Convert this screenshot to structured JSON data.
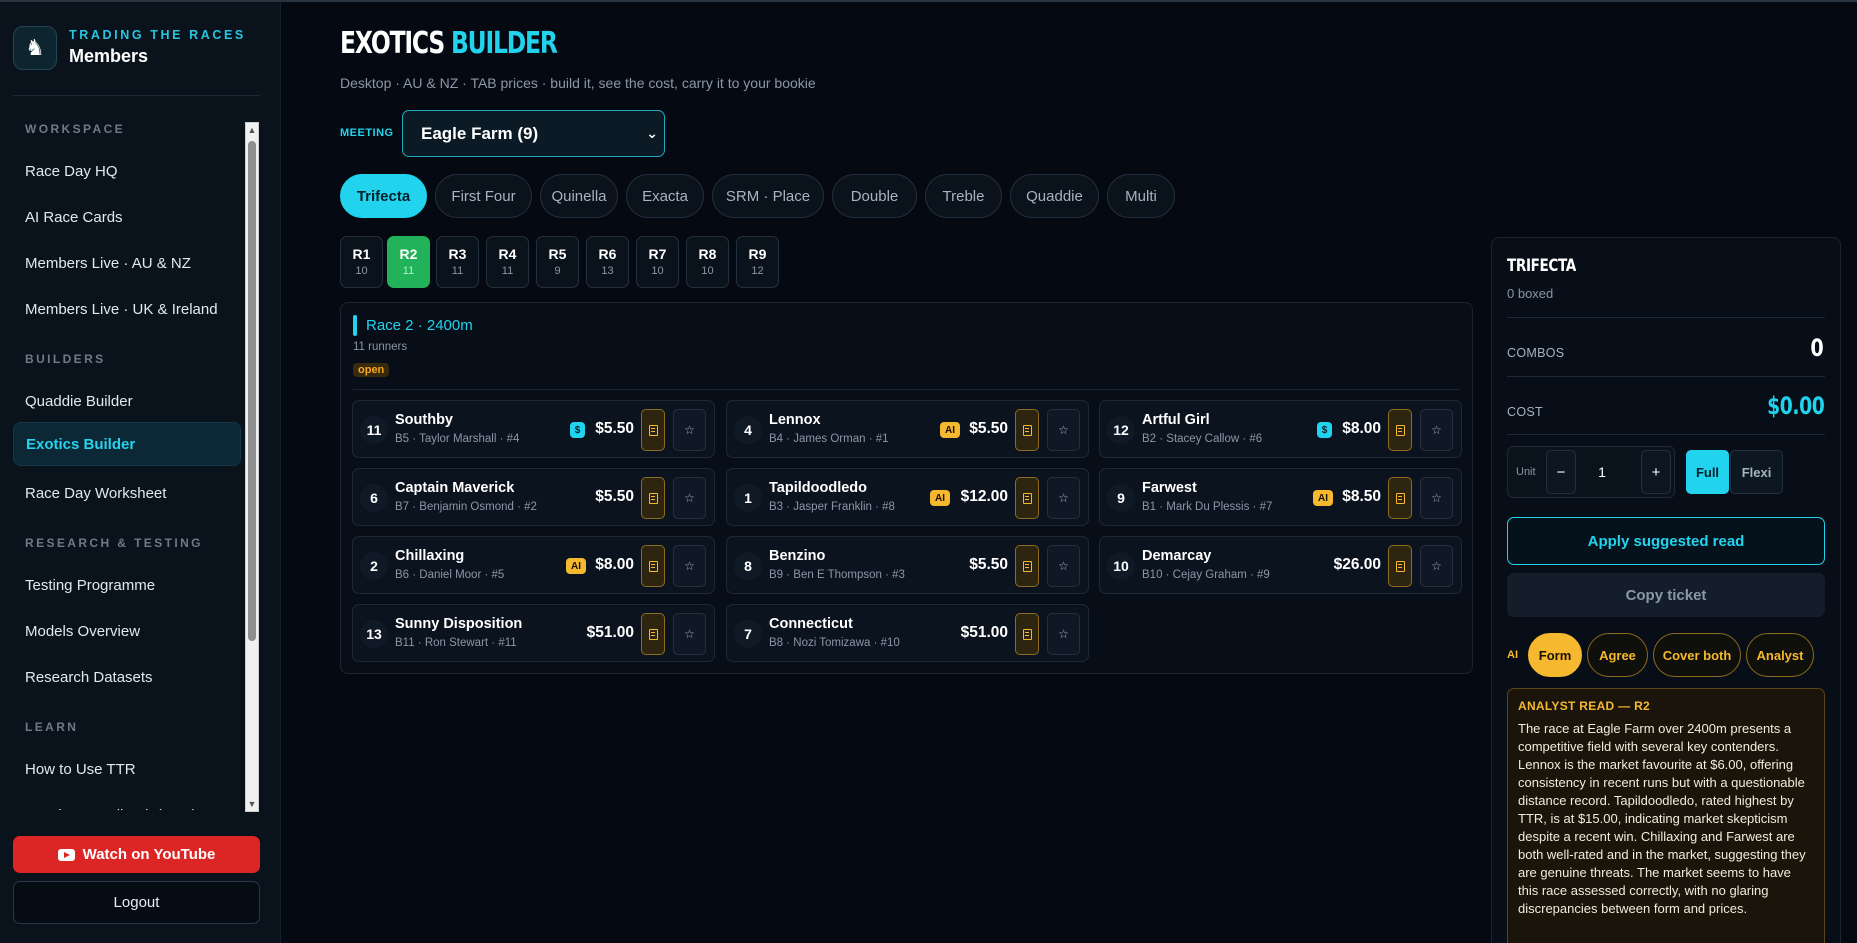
{
  "brand": {
    "kicker": "TRADING THE RACES",
    "title": "Members",
    "logo_icon": "horse-icon"
  },
  "sidebar": {
    "sections": [
      {
        "label": "WORKSPACE",
        "items": [
          "Race Day HQ",
          "AI Race Cards",
          "Members Live · AU & NZ",
          "Members Live · UK & Ireland"
        ]
      },
      {
        "label": "BUILDERS",
        "items": [
          "Quaddie Builder",
          "Exotics Builder",
          "Race Day Worksheet"
        ]
      },
      {
        "label": "RESEARCH & TESTING",
        "items": [
          "Testing Programme",
          "Models Overview",
          "Research Datasets"
        ]
      },
      {
        "label": "LEARN",
        "items": [
          "How to Use TTR",
          "Member Handbook (PDF)"
        ]
      }
    ],
    "active_item": "Exotics Builder",
    "youtube_label": "Watch on YouTube",
    "logout_label": "Logout"
  },
  "page": {
    "title_part1": "EXOTICS",
    "title_part2": "BUILDER",
    "subtitle": "Desktop · AU & NZ · TAB prices · build it, see the cost, carry it to your bookie"
  },
  "meeting": {
    "label": "MEETING",
    "selected": "Eagle Farm (9)"
  },
  "bet_types": [
    "Trifecta",
    "First Four",
    "Quinella",
    "Exacta",
    "SRM · Place",
    "Double",
    "Treble",
    "Quaddie",
    "Multi"
  ],
  "active_bet_type": "Trifecta",
  "race_tabs": [
    {
      "name": "R1",
      "count": "10"
    },
    {
      "name": "R2",
      "count": "11"
    },
    {
      "name": "R3",
      "count": "11"
    },
    {
      "name": "R4",
      "count": "11"
    },
    {
      "name": "R5",
      "count": "9"
    },
    {
      "name": "R6",
      "count": "13"
    },
    {
      "name": "R7",
      "count": "10"
    },
    {
      "name": "R8",
      "count": "10"
    },
    {
      "name": "R9",
      "count": "12"
    }
  ],
  "active_race": "R2",
  "race": {
    "name": "Race 2 · 2400m",
    "runners_label": "11 runners",
    "status": "open"
  },
  "runners": [
    {
      "num": "11",
      "name": "Southby",
      "meta": "B5 · Taylor Marshall · #4",
      "badge": "$",
      "price": "$5.50"
    },
    {
      "num": "4",
      "name": "Lennox",
      "meta": "B4 · James Orman · #1",
      "badge": "AI",
      "price": "$5.50"
    },
    {
      "num": "12",
      "name": "Artful Girl",
      "meta": "B2 · Stacey Callow · #6",
      "badge": "$",
      "price": "$8.00"
    },
    {
      "num": "6",
      "name": "Captain Maverick",
      "meta": "B7 · Benjamin Osmond · #2",
      "badge": "",
      "price": "$5.50"
    },
    {
      "num": "1",
      "name": "Tapildoodledo",
      "meta": "B3 · Jasper Franklin · #8",
      "badge": "AI",
      "price": "$12.00"
    },
    {
      "num": "9",
      "name": "Farwest",
      "meta": "B1 · Mark Du Plessis · #7",
      "badge": "AI",
      "price": "$8.50"
    },
    {
      "num": "2",
      "name": "Chillaxing",
      "meta": "B6 · Daniel Moor · #5",
      "badge": "AI",
      "price": "$8.00"
    },
    {
      "num": "8",
      "name": "Benzino",
      "meta": "B9 · Ben E Thompson · #3",
      "badge": "",
      "price": "$5.50"
    },
    {
      "num": "10",
      "name": "Demarcay",
      "meta": "B10 · Cejay Graham · #9",
      "badge": "",
      "price": "$26.00"
    },
    {
      "num": "13",
      "name": "Sunny Disposition",
      "meta": "B11 · Ron Stewart · #11",
      "badge": "",
      "price": "$51.00"
    },
    {
      "num": "7",
      "name": "Connecticut",
      "meta": "B8 · Nozi Tomizawa · #10",
      "badge": "",
      "price": "$51.00"
    }
  ],
  "ticket": {
    "title": "TRIFECTA",
    "boxed": "0 boxed",
    "combos_label": "COMBOS",
    "combos_value": "0",
    "cost_label": "COST",
    "cost_value": "$0.00",
    "unit_label": "Unit",
    "minus": "−",
    "plus": "+",
    "unit_value": "1",
    "full_label": "Full",
    "flexi_label": "Flexi",
    "apply_label": "Apply suggested read",
    "copy_label": "Copy ticket",
    "ai_label": "AI",
    "ai_modes": [
      "Form",
      "Agree",
      "Cover both",
      "Analyst"
    ],
    "active_ai_mode": "Form",
    "analyst_title": "ANALYST READ — R2",
    "analyst_body": "The race at Eagle Farm over 2400m presents a competitive field with several key contenders. Lennox is the market favourite at $6.00, offering consistency in recent runs but with a questionable distance record. Tapildoodledo, rated highest by TTR, is at $15.00, indicating market skepticism despite a recent win. Chillaxing and Farwest are both well-rated and in the market, suggesting they are genuine threats. The market seems to have this race assessed correctly, with no glaring discrepancies between form and prices."
  },
  "colors": {
    "accent": "#22d3ee",
    "active_race": "#22b35a",
    "ai_gold": "#f5b82e",
    "youtube_red": "#dc2626"
  }
}
